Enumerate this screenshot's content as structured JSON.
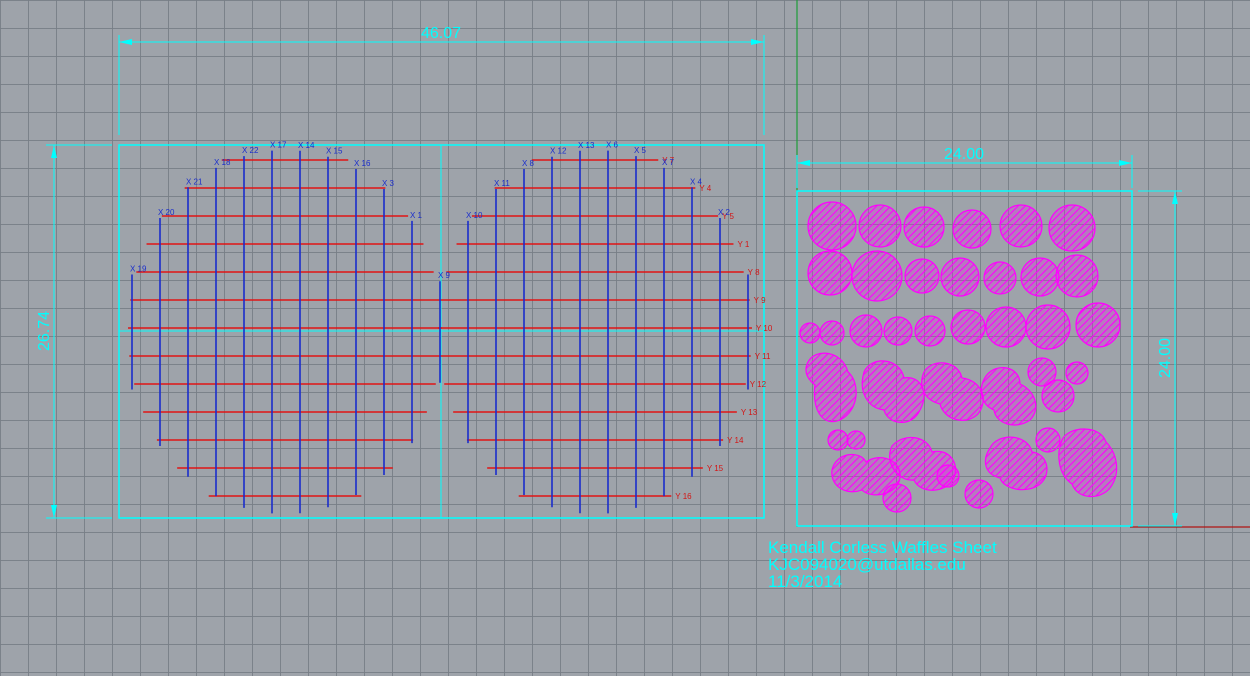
{
  "colors": {
    "background": "#9ea3aa",
    "grid": "#7f858c",
    "dimension": "#00ffff",
    "x_ribs": "#1a2dcc",
    "y_ribs": "#e01414",
    "parts": "#ff00ff",
    "axis_green": "#1e9d3a",
    "axis_red": "#b01414"
  },
  "sheet_left": {
    "width_label": "46.07",
    "height_label": "26.74",
    "x_rib_labels": [
      "X 19",
      "X 20",
      "X 21",
      "X 18",
      "X 22",
      "X 17",
      "X 14",
      "X 15",
      "X 16",
      "X 3",
      "X 1",
      "X 9",
      "X 10",
      "X 11",
      "X 8",
      "X 12",
      "X 13",
      "X 6",
      "X 5",
      "X 7",
      "X 4",
      "X 2"
    ],
    "y_rib_labels": [
      "Y 7",
      "Y 4",
      "Y 5",
      "Y 1",
      "Y 8",
      "Y 9",
      "Y 10",
      "Y 11",
      "Y 12",
      "Y 13",
      "Y 14",
      "Y 15",
      "Y 16"
    ]
  },
  "sheet_right": {
    "width_label": "24.00",
    "height_label": "24.00"
  },
  "title_block": {
    "line1": "Kendall Corless Waffles Sheet",
    "line2": "KJC094020@utdallas.edu",
    "line3": "11/3/2014"
  }
}
